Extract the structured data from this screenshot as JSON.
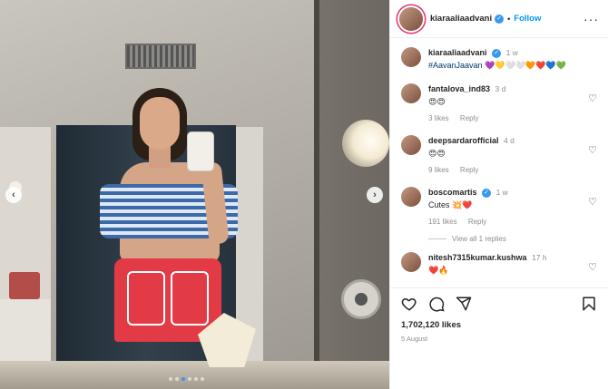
{
  "post": {
    "nav_prev": "‹",
    "nav_next": "›",
    "slide_count": 6,
    "active_slide": 2
  },
  "header": {
    "username": "kiaraaliaadvani",
    "follow_label": "Follow",
    "separator": "•",
    "more": "···"
  },
  "caption": {
    "username": "kiaraaliaadvani",
    "time": "1 w",
    "hashtag": "#AavanJaavan",
    "emojis": "💜💛🤍🤍🧡❤️💙💚"
  },
  "comments": [
    {
      "username": "fantalova_ind83",
      "verified": false,
      "time": "3 d",
      "text": "😍😍",
      "likes": "3 likes",
      "reply": "Reply"
    },
    {
      "username": "deepsardarofficial",
      "verified": false,
      "time": "4 d",
      "text": "😍😍",
      "likes": "9 likes",
      "reply": "Reply"
    },
    {
      "username": "boscomartis",
      "verified": true,
      "time": "1 w",
      "text": "Cutes 💥❤️",
      "likes": "191 likes",
      "reply": "Reply",
      "view_replies": "View all 1 replies"
    },
    {
      "username": "nitesh7315kumar.kushwa",
      "verified": false,
      "time": "17 h",
      "text": "❤️🔥"
    }
  ],
  "footer": {
    "likes": "1,702,120 likes",
    "date": "5 August"
  },
  "colors": {
    "accent": "#0095f6",
    "verified": "#3897f0",
    "muted": "#8e8e8e"
  }
}
